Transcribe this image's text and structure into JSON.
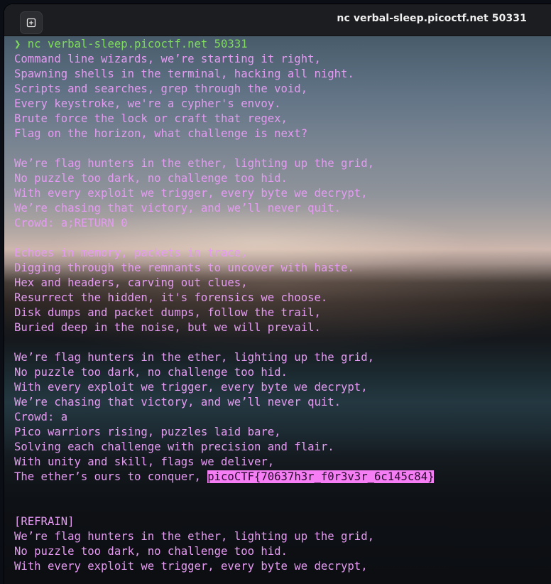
{
  "window": {
    "title": "nc verbal-sleep.picoctf.net 50331"
  },
  "icons": {
    "new_tab": "new-tab-icon"
  },
  "colors": {
    "text": "#e59bf2",
    "prompt": "#7fdc5c",
    "flag_highlight": "#f57ef5"
  },
  "terminal": {
    "prompt_symbol": "❯",
    "command": "nc verbal-sleep.picoctf.net 50331",
    "lines": [
      "Command line wizards, we’re starting it right,",
      "Spawning shells in the terminal, hacking all night.",
      "Scripts and searches, grep through the void,",
      "Every keystroke, we're a cypher's envoy.",
      "Brute force the lock or craft that regex,",
      "Flag on the horizon, what challenge is next?",
      "",
      "We’re flag hunters in the ether, lighting up the grid,",
      "No puzzle too dark, no challenge too hid.",
      "With every exploit we trigger, every byte we decrypt,",
      "We’re chasing that victory, and we’ll never quit.",
      "Crowd: a;RETURN 0",
      "",
      "Echoes in memory, packets in trace,",
      "Digging through the remnants to uncover with haste.",
      "Hex and headers, carving out clues,",
      "Resurrect the hidden, it's forensics we choose.",
      "Disk dumps and packet dumps, follow the trail,",
      "Buried deep in the noise, but we will prevail.",
      "",
      "We’re flag hunters in the ether, lighting up the grid,",
      "No puzzle too dark, no challenge too hid.",
      "With every exploit we trigger, every byte we decrypt,",
      "We’re chasing that victory, and we’ll never quit.",
      "Crowd: a",
      "Pico warriors rising, puzzles laid bare,",
      "Solving each challenge with precision and flair.",
      "With unity and skill, flags we deliver,"
    ],
    "flag_line_prefix": "The ether’s ours to conquer, ",
    "flag": "picoCTF{70637h3r_f0r3v3r_6c145c84}",
    "lines_after": [
      "",
      "",
      "[REFRAIN]",
      "We’re flag hunters in the ether, lighting up the grid,",
      "No puzzle too dark, no challenge too hid.",
      "With every exploit we trigger, every byte we decrypt,"
    ]
  }
}
